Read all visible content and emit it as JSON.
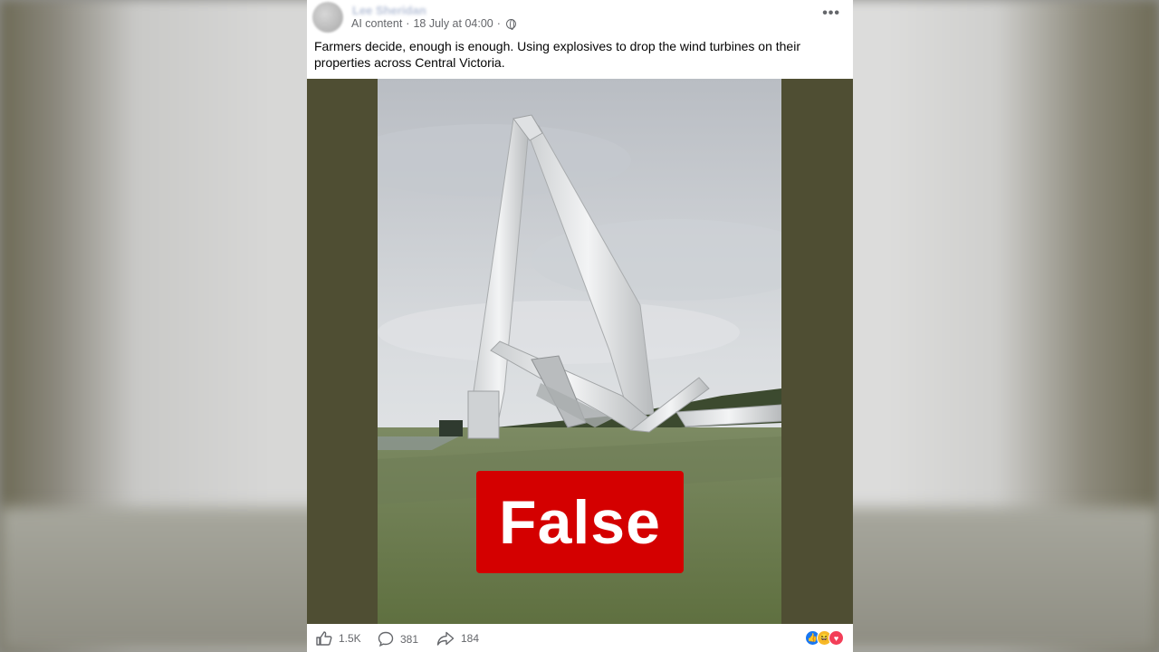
{
  "post": {
    "author": "Lee Sheridan",
    "meta_label": "AI content",
    "date": "18 July at 04:00",
    "caption": "Farmers decide, enough is enough. Using explosives to drop the wind turbines on their properties across Central Victoria.",
    "more_icon": "more-options-icon",
    "globe_icon": "globe-icon"
  },
  "overlay": {
    "verdict": "False",
    "color": "#d40000"
  },
  "actions": {
    "likes": "1.5K",
    "comments": "381",
    "shares": "184"
  },
  "reactions": [
    {
      "name": "like",
      "color": "#1877f2"
    },
    {
      "name": "haha",
      "color": "#f7b928"
    },
    {
      "name": "love",
      "color": "#f33e58"
    }
  ]
}
